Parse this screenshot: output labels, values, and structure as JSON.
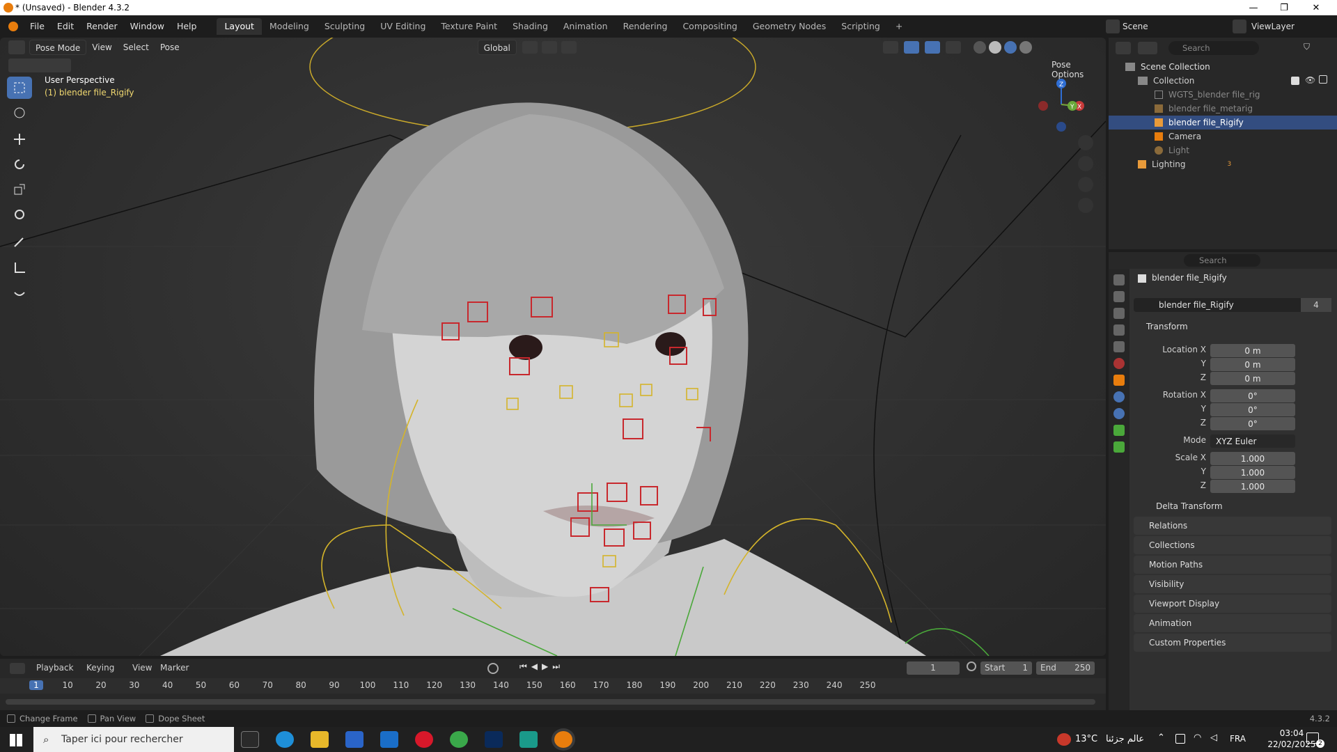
{
  "window": {
    "title": "* (Unsaved) - Blender 4.3.2",
    "minimize": "—",
    "restore": "❐",
    "close": "✕"
  },
  "menubar": {
    "menus": [
      "File",
      "Edit",
      "Render",
      "Window",
      "Help"
    ],
    "workspaces": [
      "Layout",
      "Modeling",
      "Sculpting",
      "UV Editing",
      "Texture Paint",
      "Shading",
      "Animation",
      "Rendering",
      "Compositing",
      "Geometry Nodes",
      "Scripting"
    ],
    "active_workspace": "Layout",
    "add_tab": "+",
    "scene_label": "Scene",
    "viewlayer_label": "ViewLayer"
  },
  "viewport": {
    "mode": "Pose Mode",
    "menus": [
      "View",
      "Select",
      "Pose"
    ],
    "orientation": "Global",
    "pose_options": "Pose Options",
    "perspective_label": "User Perspective",
    "object_label": "(1) blender file_Rigify",
    "gizmo_axes": [
      "X",
      "Y",
      "Z"
    ]
  },
  "outliner": {
    "search_placeholder": "Search",
    "root": "Scene Collection",
    "items": [
      {
        "label": "Collection"
      },
      {
        "label": "WGTS_blender file_rig"
      },
      {
        "label": "blender file_metarig"
      },
      {
        "label": "blender file_Rigify"
      },
      {
        "label": "Camera"
      },
      {
        "label": "Light"
      },
      {
        "label": "Lighting"
      }
    ],
    "lighting_count": "3"
  },
  "properties": {
    "search_placeholder": "Search",
    "object_name": "blender file_Rigify",
    "data_name": "blender file_Rigify",
    "users": "4",
    "transform_header": "Transform",
    "location": {
      "label_x": "Location X",
      "label_y": "Y",
      "label_z": "Z",
      "x": "0 m",
      "y": "0 m",
      "z": "0 m"
    },
    "rotation": {
      "label_x": "Rotation X",
      "label_y": "Y",
      "label_z": "Z",
      "x": "0°",
      "y": "0°",
      "z": "0°"
    },
    "mode_label": "Mode",
    "mode_value": "XYZ Euler",
    "scale": {
      "label_x": "Scale X",
      "label_y": "Y",
      "label_z": "Z",
      "x": "1.000",
      "y": "1.000",
      "z": "1.000"
    },
    "delta_transform": "Delta Transform",
    "panels": [
      "Relations",
      "Collections",
      "Motion Paths",
      "Visibility",
      "Viewport Display",
      "Animation",
      "Custom Properties"
    ]
  },
  "timeline": {
    "menus": [
      "Playback",
      "Keying",
      "View",
      "Marker"
    ],
    "current_frame": "1",
    "start_label": "Start",
    "start": "1",
    "end_label": "End",
    "end": "250",
    "ruler": [
      "1",
      "10",
      "20",
      "30",
      "40",
      "50",
      "60",
      "70",
      "80",
      "90",
      "100",
      "110",
      "120",
      "130",
      "140",
      "150",
      "160",
      "170",
      "180",
      "190",
      "200",
      "210",
      "220",
      "230",
      "240",
      "250"
    ]
  },
  "statusbar": {
    "hints": [
      "Change Frame",
      "Pan View",
      "Dope Sheet"
    ],
    "version": "4.3.2"
  },
  "taskbar": {
    "search_placeholder": "Taper ici pour rechercher",
    "weather": "13°C",
    "weather_text": "عالم جزئنا",
    "language": "FRA",
    "time": "03:04",
    "date": "22/02/2025",
    "notifications": "2"
  },
  "colors": {
    "accent": "#4772b3",
    "selected_row": "#334d80",
    "bone_red": "#c8282d",
    "bone_yellow": "#d4b42a",
    "bone_green": "#4aa83a"
  }
}
